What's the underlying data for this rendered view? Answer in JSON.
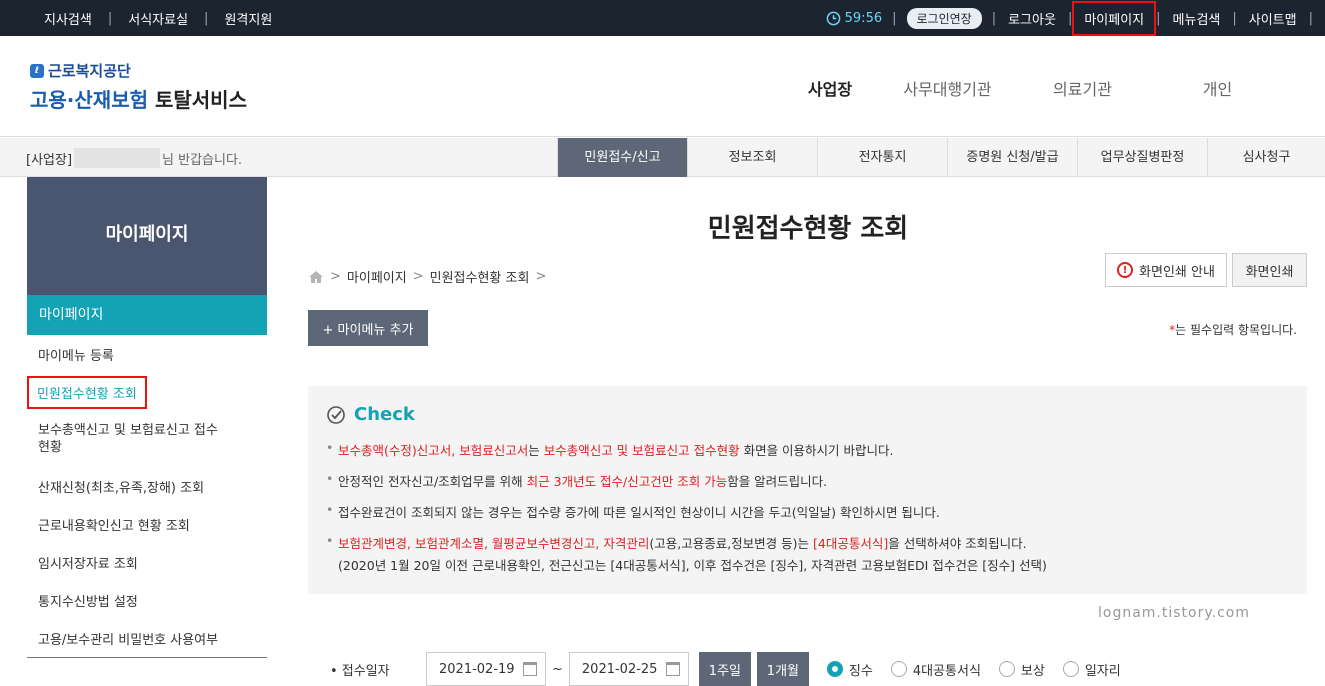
{
  "topbar": {
    "links": [
      "지사검색",
      "서식자료실",
      "원격지원"
    ],
    "timer": "59:56",
    "extend": "로그인연장",
    "logout": "로그아웃",
    "mypage": "마이페이지",
    "menu_search": "메뉴검색",
    "sitemap": "사이트맵"
  },
  "logo": {
    "org": "근로복지공단",
    "svc_a": "고용·산재보험",
    "svc_b": "토탈서비스"
  },
  "mainnav": [
    "사업장",
    "사무대행기관",
    "의료기관",
    "개인"
  ],
  "greeting": {
    "prefix": "[사업장]",
    "suffix": "님 반갑습니다."
  },
  "submenu": [
    "민원접수/신고",
    "정보조회",
    "전자통지",
    "증명원 신청/발급",
    "업무상질병판정",
    "심사청구"
  ],
  "sidebar": {
    "heading": "마이페이지",
    "current": "마이페이지",
    "items": [
      "마이메뉴 등록",
      "민원접수현황 조회",
      "보수총액신고 및 보험료신고 접수현황",
      "산재신청(최초,유족,장해) 조회",
      "근로내용확인신고 현황 조회",
      "임시저장자료 조회",
      "통지수신방법 설정",
      "고용/보수관리 비밀번호 사용여부"
    ]
  },
  "content": {
    "title": "민원접수현황 조회",
    "breadcrumb": [
      "마이페이지",
      "민원접수현황 조회"
    ],
    "print_guide": "화면인쇄 안내",
    "print": "화면인쇄",
    "add_menu": "+ 마이메뉴 추가",
    "required_star": "*",
    "required_text": "는 필수입력 항목입니다."
  },
  "check": {
    "heading": "Check",
    "l1_red1": "보수총액(수정)신고서, 보험료신고서",
    "l1_t1": "는 ",
    "l1_red2": "보수총액신고 및 보험료신고 접수현황",
    "l1_t2": " 화면을 이용하시기 바랍니다.",
    "l2_t1": "안정적인 전자신고/조회업무를 위해 ",
    "l2_red": "최근 3개년도 접수/신고건만 조회 가능",
    "l2_t2": "함을 알려드립니다.",
    "l3": "접수완료건이 조회되지 않는 경우는 접수량 증가에 따른 일시적인 현상이니 시간을 두고(익일날) 확인하시면 됩니다.",
    "l4_red1": "보험관계변경, 보험관계소멸, 월평균보수변경신고, 자격관리",
    "l4_t1": "(고용,고용종료,정보변경 등)는 ",
    "l4_red2": "[4대공통서식]",
    "l4_t2": "을 선택하셔야 조회됩니다.",
    "l4_sub": "(2020년 1월 20일 이전 근로내용확인, 전근신고는 [4대공통서식], 이후 접수건은 [징수], 자격관련 고용보험EDI 접수건은 [징수] 선택)"
  },
  "watermark": "lognam.tistory.com",
  "search": {
    "label": "• 접수일자",
    "date_from": "2021-02-19",
    "tilde": "~",
    "date_to": "2021-02-25",
    "btn_week": "1주일",
    "btn_month": "1개월",
    "radios": [
      "징수",
      "4대공통서식",
      "보상",
      "일자리"
    ],
    "selected_radio": "징수"
  },
  "colors": {
    "teal": "#13a3b4",
    "dark": "#1c2430",
    "slate": "#5d6777",
    "red": "#dd2222"
  }
}
